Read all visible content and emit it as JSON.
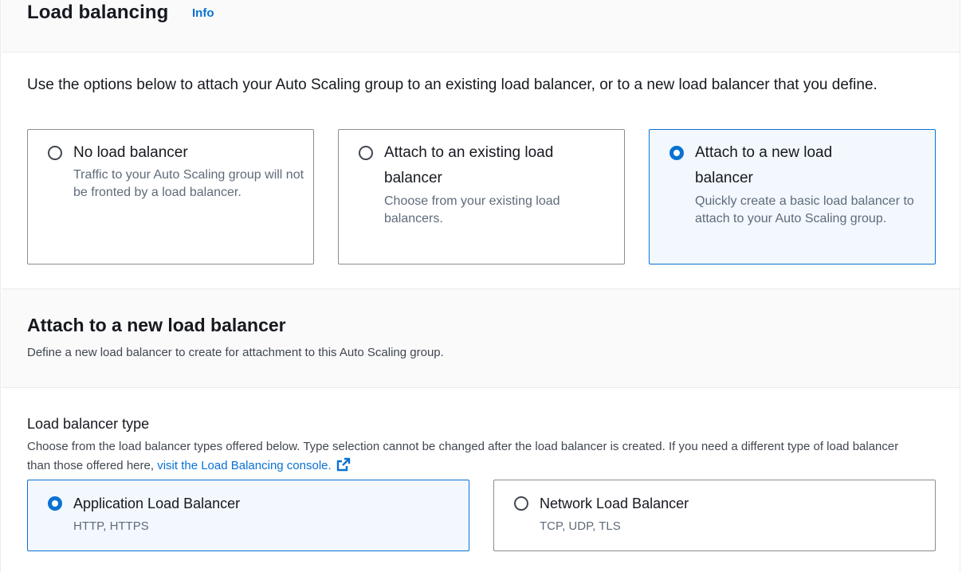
{
  "header": {
    "title": "Load balancing",
    "info": "Info"
  },
  "intro": "Use the options below to attach your Auto Scaling group to an existing load balancer, or to a new load balancer that you define.",
  "options": [
    {
      "title": "No load balancer",
      "description": "Traffic to your Auto Scaling group will not be fronted by a load balancer.",
      "selected": false
    },
    {
      "title": "Attach to an existing load balancer",
      "description": "Choose from your existing load balancers.",
      "selected": false
    },
    {
      "title": "Attach to a new load balancer",
      "description": "Quickly create a basic load balancer to attach to your Auto Scaling group.",
      "selected": true
    }
  ],
  "new_lb_section": {
    "title": "Attach to a new load balancer",
    "description": "Define a new load balancer to create for attachment to this Auto Scaling group."
  },
  "lb_type": {
    "label": "Load balancer type",
    "description": "Choose from the load balancer types offered below. Type selection cannot be changed after the load balancer is created. If you need a different type of load balancer than those offered here,",
    "link_text": "visit the Load Balancing console.",
    "options": [
      {
        "title": "Application Load Balancer",
        "description": "HTTP, HTTPS",
        "selected": true
      },
      {
        "title": "Network Load Balancer",
        "description": "TCP, UDP, TLS",
        "selected": false
      }
    ]
  },
  "colors": {
    "accent": "#0972d3",
    "selected_bg": "#f2f8fd",
    "band_bg": "#fafafa"
  }
}
